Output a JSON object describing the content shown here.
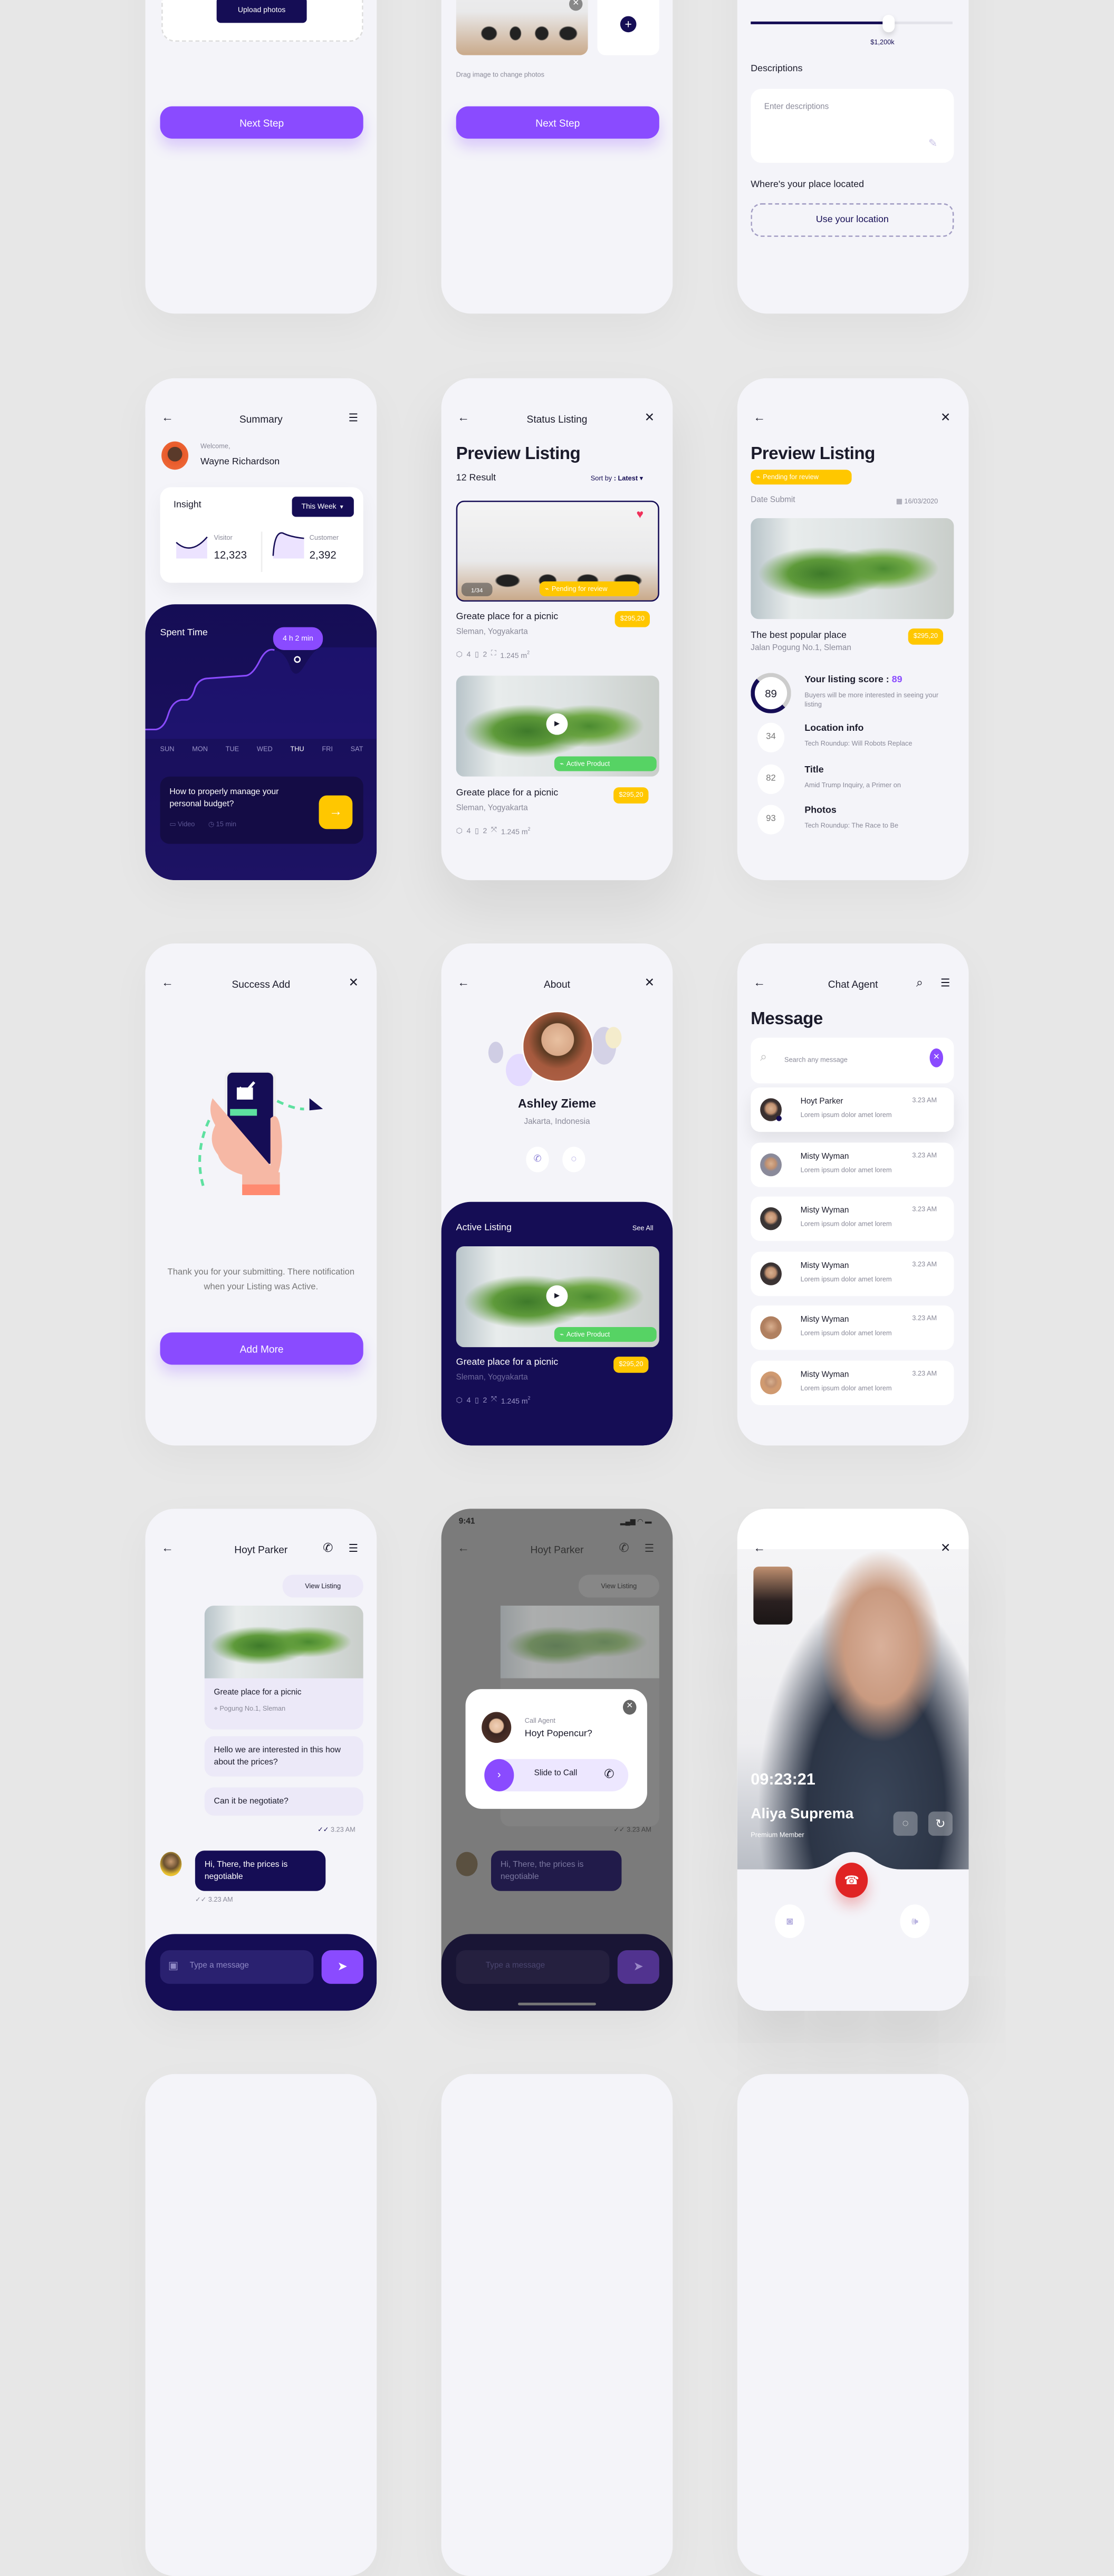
{
  "colors": {
    "accent": "#8a4bff",
    "navy": "#150d55",
    "yellow": "#ffc700",
    "green": "#56d364",
    "danger": "#e02424"
  },
  "upload": {
    "upload_button": "Upload photos",
    "next_button": "Next Step"
  },
  "photos": {
    "hint": "Drag image to change photos",
    "next_button": "Next Step"
  },
  "details": {
    "price_value": "$1,200k",
    "descriptions_label": "Descriptions",
    "descriptions_placeholder": "Enter descriptions",
    "location_label": "Where's your place located",
    "location_button": "Use your location"
  },
  "summary": {
    "title": "Summary",
    "welcome": "Welcome,",
    "user_name": "Wayne Richardson",
    "insight_label": "Insight",
    "period_select": "This Week",
    "visitor_label": "Visitor",
    "visitor_value": "12,323",
    "customer_label": "Customer",
    "customer_value": "2,392",
    "spent_time_label": "Spent Time",
    "spent_time_value": "4 h 2 min",
    "days": [
      "SUN",
      "MON",
      "TUE",
      "WED",
      "THU",
      "FRI",
      "SAT"
    ],
    "selected_day": "THU",
    "tip_title": "How to properly manage your personal budget?",
    "tip_type": "Video",
    "tip_duration": "15 min"
  },
  "status": {
    "title": "Status Listing",
    "heading": "Preview Listing",
    "result_count": "12 Result",
    "sort_label": "Sort by",
    "sort_value": ": Latest",
    "listings": [
      {
        "title": "Greate place for a picnic",
        "location": "Sleman, Yogyakarta",
        "price": "$295,20",
        "beds": "4",
        "baths": "2",
        "area": "1.245 m",
        "area_sup": "2",
        "status": "Pending for review",
        "photo_counter": "1/34",
        "favorite": true
      },
      {
        "title": "Greate place for a picnic",
        "location": "Sleman, Yogyakarta",
        "price": "$295,20",
        "beds": "4",
        "baths": "2",
        "area": "1.245 m",
        "area_sup": "2",
        "status": "Active Product"
      }
    ]
  },
  "preview": {
    "heading": "Preview Listing",
    "status": "Pending for review",
    "date_label": "Date Submit",
    "date_value": "16/03/2020",
    "title": "The best popular place",
    "address": "Jalan Pogung No.1, Sleman",
    "price": "$295,20",
    "score": "89",
    "score_label": "Your listing score :",
    "score_desc": "Buyers will be more interested in seeing your listing",
    "items": [
      {
        "score": "34",
        "title": "Location info",
        "desc": "Tech Roundup: Will Robots Replace"
      },
      {
        "score": "82",
        "title": "Title",
        "desc": "Amid Trump Inquiry, a Primer on"
      },
      {
        "score": "93",
        "title": "Photos",
        "desc": "Tech Roundup: The Race to Be"
      }
    ]
  },
  "success": {
    "title": "Success Add",
    "message": "Thank you for your submitting. There notification when your Listing was Active.",
    "button": "Add More"
  },
  "about": {
    "title": "About",
    "name": "Ashley Zieme",
    "location": "Jakarta, Indonesia",
    "active_label": "Active Listing",
    "see_all": "See All",
    "listing": {
      "title": "Greate place for a picnic",
      "location": "Sleman, Yogyakarta",
      "price": "$295,20",
      "beds": "4",
      "baths": "2",
      "area": "1.245 m",
      "area_sup": "2",
      "status": "Active Product"
    }
  },
  "chat_agent": {
    "title": "Chat Agent",
    "heading": "Message",
    "search_placeholder": "Search any message",
    "messages": [
      {
        "name": "Hoyt Parker",
        "preview": "Lorem ipsum dolor amet lorem",
        "time": "3.23 AM",
        "online": true
      },
      {
        "name": "Misty Wyman",
        "preview": "Lorem ipsum dolor amet lorem",
        "time": "3.23 AM"
      },
      {
        "name": "Misty Wyman",
        "preview": "Lorem ipsum dolor amet lorem",
        "time": "3.23 AM"
      },
      {
        "name": "Misty Wyman",
        "preview": "Lorem ipsum dolor amet lorem",
        "time": "3.23 AM"
      },
      {
        "name": "Misty Wyman",
        "preview": "Lorem ipsum dolor amet lorem",
        "time": "3.23 AM"
      },
      {
        "name": "Misty Wyman",
        "preview": "Lorem ipsum dolor amet lorem",
        "time": "3.23 AM"
      }
    ]
  },
  "chat": {
    "title": "Hoyt Parker",
    "view_listing": "View Listing",
    "listing_title": "Greate place for a picnic",
    "listing_location": "Pogung No.1, Sleman",
    "msg1": "Hello we are interested in this how about the prices?",
    "msg2": "Can it be negotiate?",
    "sent_time": "3.23 AM",
    "reply": "Hi, There, the prices is negotiable",
    "reply_time": "3.23 AM",
    "input_placeholder": "Type a message"
  },
  "call_modal": {
    "status_time": "9:41",
    "label": "Call Agent",
    "name": "Hoyt  Popencur?",
    "slider": "Slide to Call"
  },
  "video_call": {
    "timer": "09:23:21",
    "name": "Aliya Suprema",
    "role": "Premium Member"
  }
}
